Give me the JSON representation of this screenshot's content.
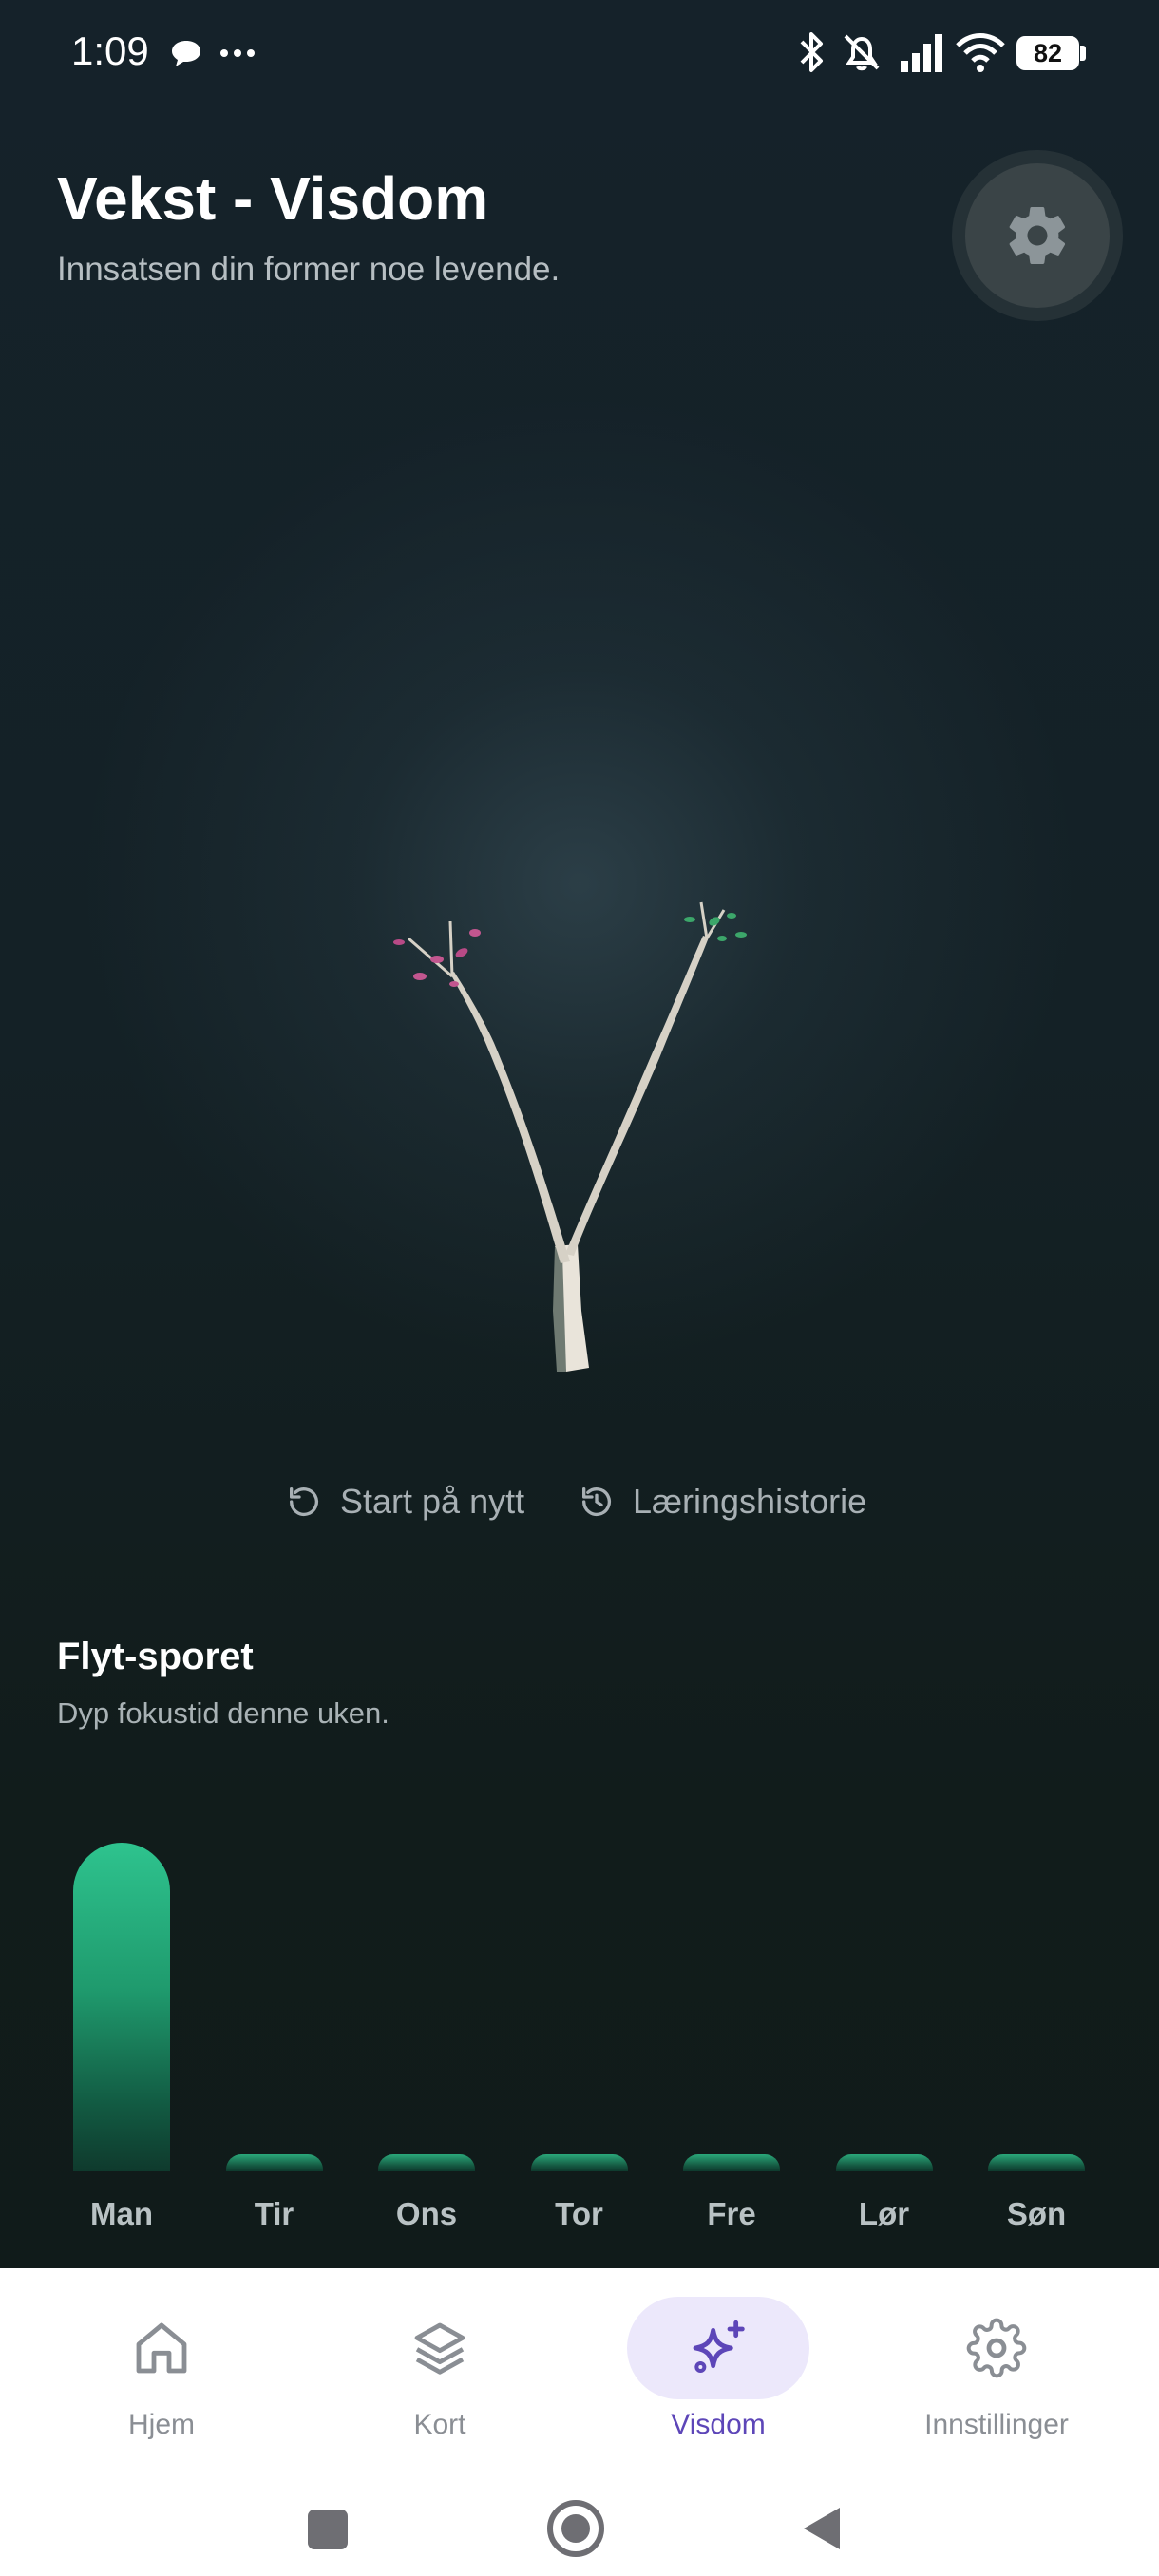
{
  "status_bar": {
    "time": "1:09",
    "battery": "82",
    "icons": [
      "chat-bubble-icon",
      "more-dots-icon",
      "bluetooth-icon",
      "mute-bell-icon",
      "signal-icon",
      "wifi-icon",
      "battery-icon"
    ]
  },
  "header": {
    "title": "Vekst - Visdom",
    "subtitle": "Innsatsen din former noe levende.",
    "settings_icon": "gear-icon"
  },
  "actions": {
    "restart_label": "Start på nytt",
    "history_label": "Læringshistorie"
  },
  "flow_track": {
    "title": "Flyt-sporet",
    "subtitle": "Dyp fokustid denne uken.",
    "chart_data": {
      "type": "bar",
      "categories": [
        "Man",
        "Tir",
        "Ons",
        "Tor",
        "Fre",
        "Lør",
        "Søn"
      ],
      "values": [
        1,
        0.05,
        0.05,
        0.05,
        0.05,
        0.05,
        0.05
      ],
      "ylim": [
        0,
        1
      ],
      "grid": false,
      "colors": {
        "bar_top": "#2ec38e",
        "bar_bottom": "#0f3a2d"
      }
    }
  },
  "bottom_nav": {
    "items": [
      {
        "label": "Hjem",
        "icon": "home-icon",
        "active": false
      },
      {
        "label": "Kort",
        "icon": "layers-icon",
        "active": false
      },
      {
        "label": "Visdom",
        "icon": "sparkle-icon",
        "active": true
      },
      {
        "label": "Innstillinger",
        "icon": "gear-icon",
        "active": false
      }
    ],
    "accent": "#5d46b8"
  }
}
